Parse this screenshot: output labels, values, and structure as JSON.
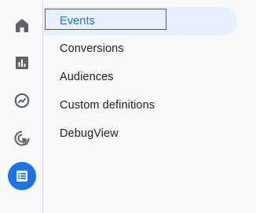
{
  "colors": {
    "accent": "#1a73e8",
    "icon": "#5f6368",
    "highlight": "#d9272e"
  },
  "rail": {
    "items": [
      {
        "icon": "home-icon",
        "active": false
      },
      {
        "icon": "reports-icon",
        "active": false
      },
      {
        "icon": "explore-icon",
        "active": false
      },
      {
        "icon": "advertising-icon",
        "active": false
      },
      {
        "icon": "configure-icon",
        "active": true
      }
    ]
  },
  "menu": {
    "items": [
      {
        "label": "Events",
        "active": true
      },
      {
        "label": "Conversions",
        "active": false
      },
      {
        "label": "Audiences",
        "active": false
      },
      {
        "label": "Custom definitions",
        "active": false
      },
      {
        "label": "DebugView",
        "active": false
      }
    ]
  }
}
